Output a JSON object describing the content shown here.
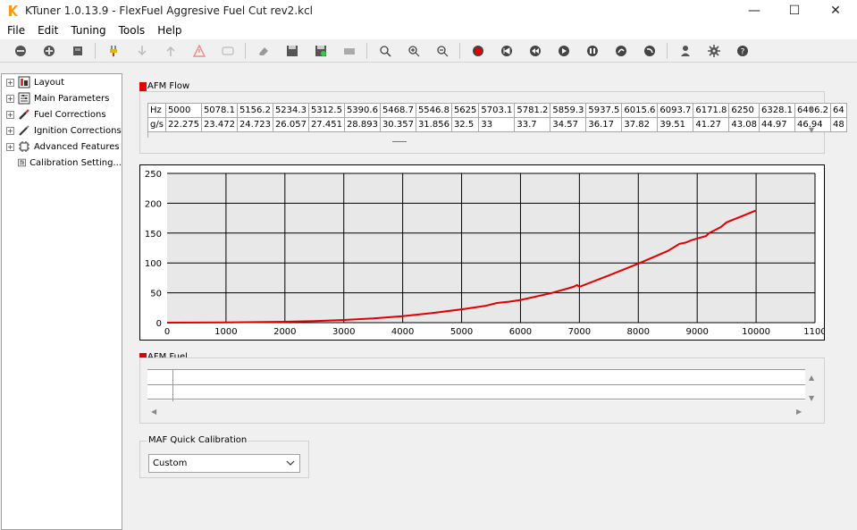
{
  "window": {
    "title": "KTuner 1.0.13.9 - FlexFuel Aggresive Fuel Cut rev2.kcl",
    "minimize": "—",
    "maximize": "☐",
    "close": "✕"
  },
  "menu": [
    "File",
    "Edit",
    "Tuning",
    "Tools",
    "Help"
  ],
  "toolbar_icons": [
    "disconnect-icon",
    "connect-icon",
    "chip-icon",
    "plug-icon",
    "download-icon",
    "upload-icon",
    "warning-icon",
    "screen-icon",
    "eraser-icon",
    "save-icon",
    "save-green-icon",
    "device-icon",
    "zoom-icon",
    "zoom-in-icon",
    "zoom-out-icon",
    "record-icon",
    "rewind-icon",
    "step-back-icon",
    "play-icon",
    "pause-icon",
    "step-forward-icon",
    "forward-icon",
    "user-icon",
    "gear-icon",
    "help-icon"
  ],
  "sidebar": {
    "items": [
      {
        "label": "Layout",
        "icon": "layout-icon",
        "expandable": true
      },
      {
        "label": "Main Parameters",
        "icon": "parameters-icon",
        "expandable": true
      },
      {
        "label": "Fuel Corrections",
        "icon": "injector-icon",
        "expandable": true
      },
      {
        "label": "Ignition Corrections",
        "icon": "spark-plug-icon",
        "expandable": true
      },
      {
        "label": "Advanced Features",
        "icon": "chip-icon",
        "expandable": true
      },
      {
        "label": "Calibration Setting...",
        "icon": "parameters-icon",
        "expandable": false
      }
    ]
  },
  "afm_flow": {
    "label": "AFM Flow",
    "rows": [
      {
        "header": "Hz",
        "cells": [
          "5000",
          "5078.1",
          "5156.2",
          "5234.3",
          "5312.5",
          "5390.6",
          "5468.7",
          "5546.8",
          "5625",
          "5703.1",
          "5781.2",
          "5859.3",
          "5937.5",
          "6015.6",
          "6093.7",
          "6171.8",
          "6250",
          "6328.1",
          "6406.2",
          "64"
        ]
      },
      {
        "header": "g/s",
        "cells": [
          "22.275",
          "23.472",
          "24.723",
          "26.057",
          "27.451",
          "28.893",
          "30.357",
          "31.856",
          "32.5",
          "33",
          "33.7",
          "34.57",
          "36.17",
          "37.82",
          "39.51",
          "41.27",
          "43.08",
          "44.97",
          "46.94",
          "48"
        ]
      }
    ]
  },
  "chart_data": {
    "type": "line",
    "title": "",
    "xlabel": "",
    "ylabel": "",
    "xlim": [
      0,
      11000
    ],
    "ylim": [
      0,
      250
    ],
    "x_ticks": [
      "0",
      "1000",
      "2000",
      "3000",
      "4000",
      "5000",
      "6000",
      "7000",
      "8000",
      "9000",
      "10000",
      "1100"
    ],
    "y_ticks": [
      "0",
      "50",
      "100",
      "150",
      "200",
      "250"
    ],
    "grid": true,
    "series": [
      {
        "color": "#e00000",
        "x": [
          0,
          1000,
          2000,
          2500,
          3000,
          3500,
          4000,
          4500,
          5000,
          5400,
          5600,
          5800,
          6000,
          6500,
          6900,
          6960,
          7000,
          7500,
          8000,
          8500,
          8700,
          8800,
          8900,
          9000,
          9150,
          9200,
          9300,
          9400,
          9500,
          9600,
          9700,
          9800,
          9900,
          10000
        ],
        "y": [
          0,
          0.3,
          1.5,
          2.5,
          4.5,
          7,
          11,
          16,
          22.3,
          28,
          33,
          35,
          38,
          49,
          60,
          63,
          60,
          79,
          99,
          120,
          132,
          134,
          138,
          141,
          145,
          150,
          155,
          160,
          168,
          172,
          176,
          180,
          184,
          188
        ]
      }
    ]
  },
  "afm_fuel": {
    "label": "AFM Fuel"
  },
  "maf": {
    "label": "MAF Quick Calibration",
    "selected": "Custom"
  }
}
